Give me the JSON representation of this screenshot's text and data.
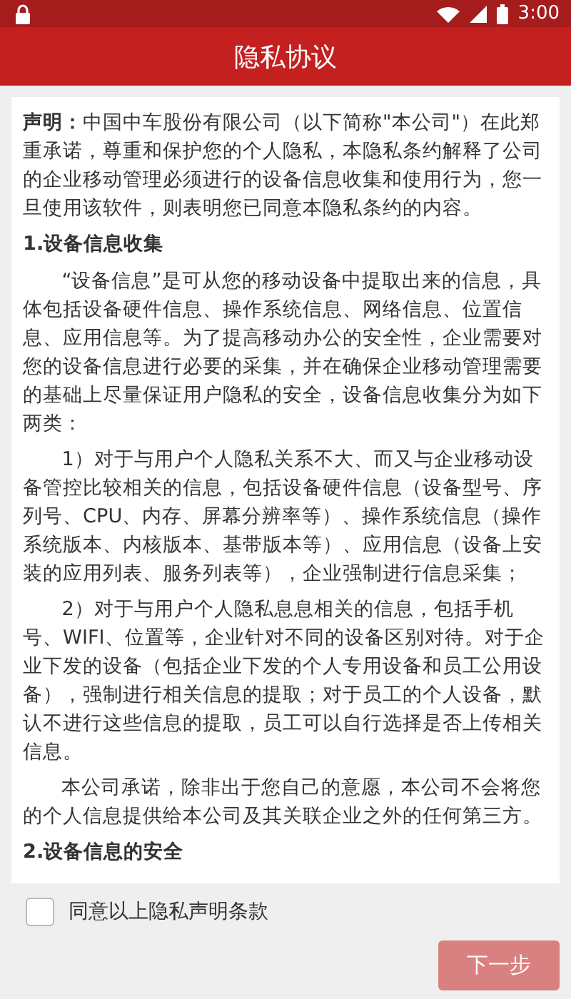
{
  "status_bar": {
    "time": "3:00"
  },
  "header": {
    "title": "隐私协议"
  },
  "agreement": {
    "blocks": [
      {
        "kind": "paragraph",
        "indent": false,
        "text": "**声明：**中国中车股份有限公司（以下简称\"本公司\"）在此郑重承诺，尊重和保护您的个人隐私，本隐私条约解释了公司的企业移动管理必须进行的设备信息收集和使用行为，您一旦使用该软件，则表明您已同意本隐私条约的内容。"
      },
      {
        "kind": "heading",
        "indent": false,
        "text": "1.设备信息收集"
      },
      {
        "kind": "paragraph",
        "indent": true,
        "text": "“设备信息”是可从您的移动设备中提取出来的信息，具体包括设备硬件信息、操作系统信息、网络信息、位置信息、应用信息等。为了提高移动办公的安全性，企业需要对您的设备信息进行必要的采集，并在确保企业移动管理需要的基础上尽量保证用户隐私的安全，设备信息收集分为如下两类："
      },
      {
        "kind": "paragraph",
        "indent": true,
        "text": "1）对于与用户个人隐私关系不大、而又与企业移动设备管控比较相关的信息，包括设备硬件信息（设备型号、序列号、CPU、内存、屏幕分辨率等）、操作系统信息（操作系统版本、内核版本、基带版本等）、应用信息（设备上安装的应用列表、服务列表等），企业强制进行信息采集；"
      },
      {
        "kind": "paragraph",
        "indent": true,
        "text": "2）对于与用户个人隐私息息相关的信息，包括手机号、WIFI、位置等，企业针对不同的设备区别对待。对于企业下发的设备（包括企业下发的个人专用设备和员工公用设备），强制进行相关信息的提取；对于员工的个人设备，默认不进行这些信息的提取，员工可以自行选择是否上传相关信息。"
      },
      {
        "kind": "paragraph",
        "indent": true,
        "text": "本公司承诺，除非出于您自己的意愿，本公司不会将您的个人信息提供给本公司及其关联企业之外的任何第三方。"
      },
      {
        "kind": "heading",
        "indent": false,
        "text": "2.设备信息的安全"
      }
    ]
  },
  "consent": {
    "label": "同意以上隐私声明条款",
    "checked": false
  },
  "next_button": {
    "label": "下一步",
    "disabled": true
  }
}
